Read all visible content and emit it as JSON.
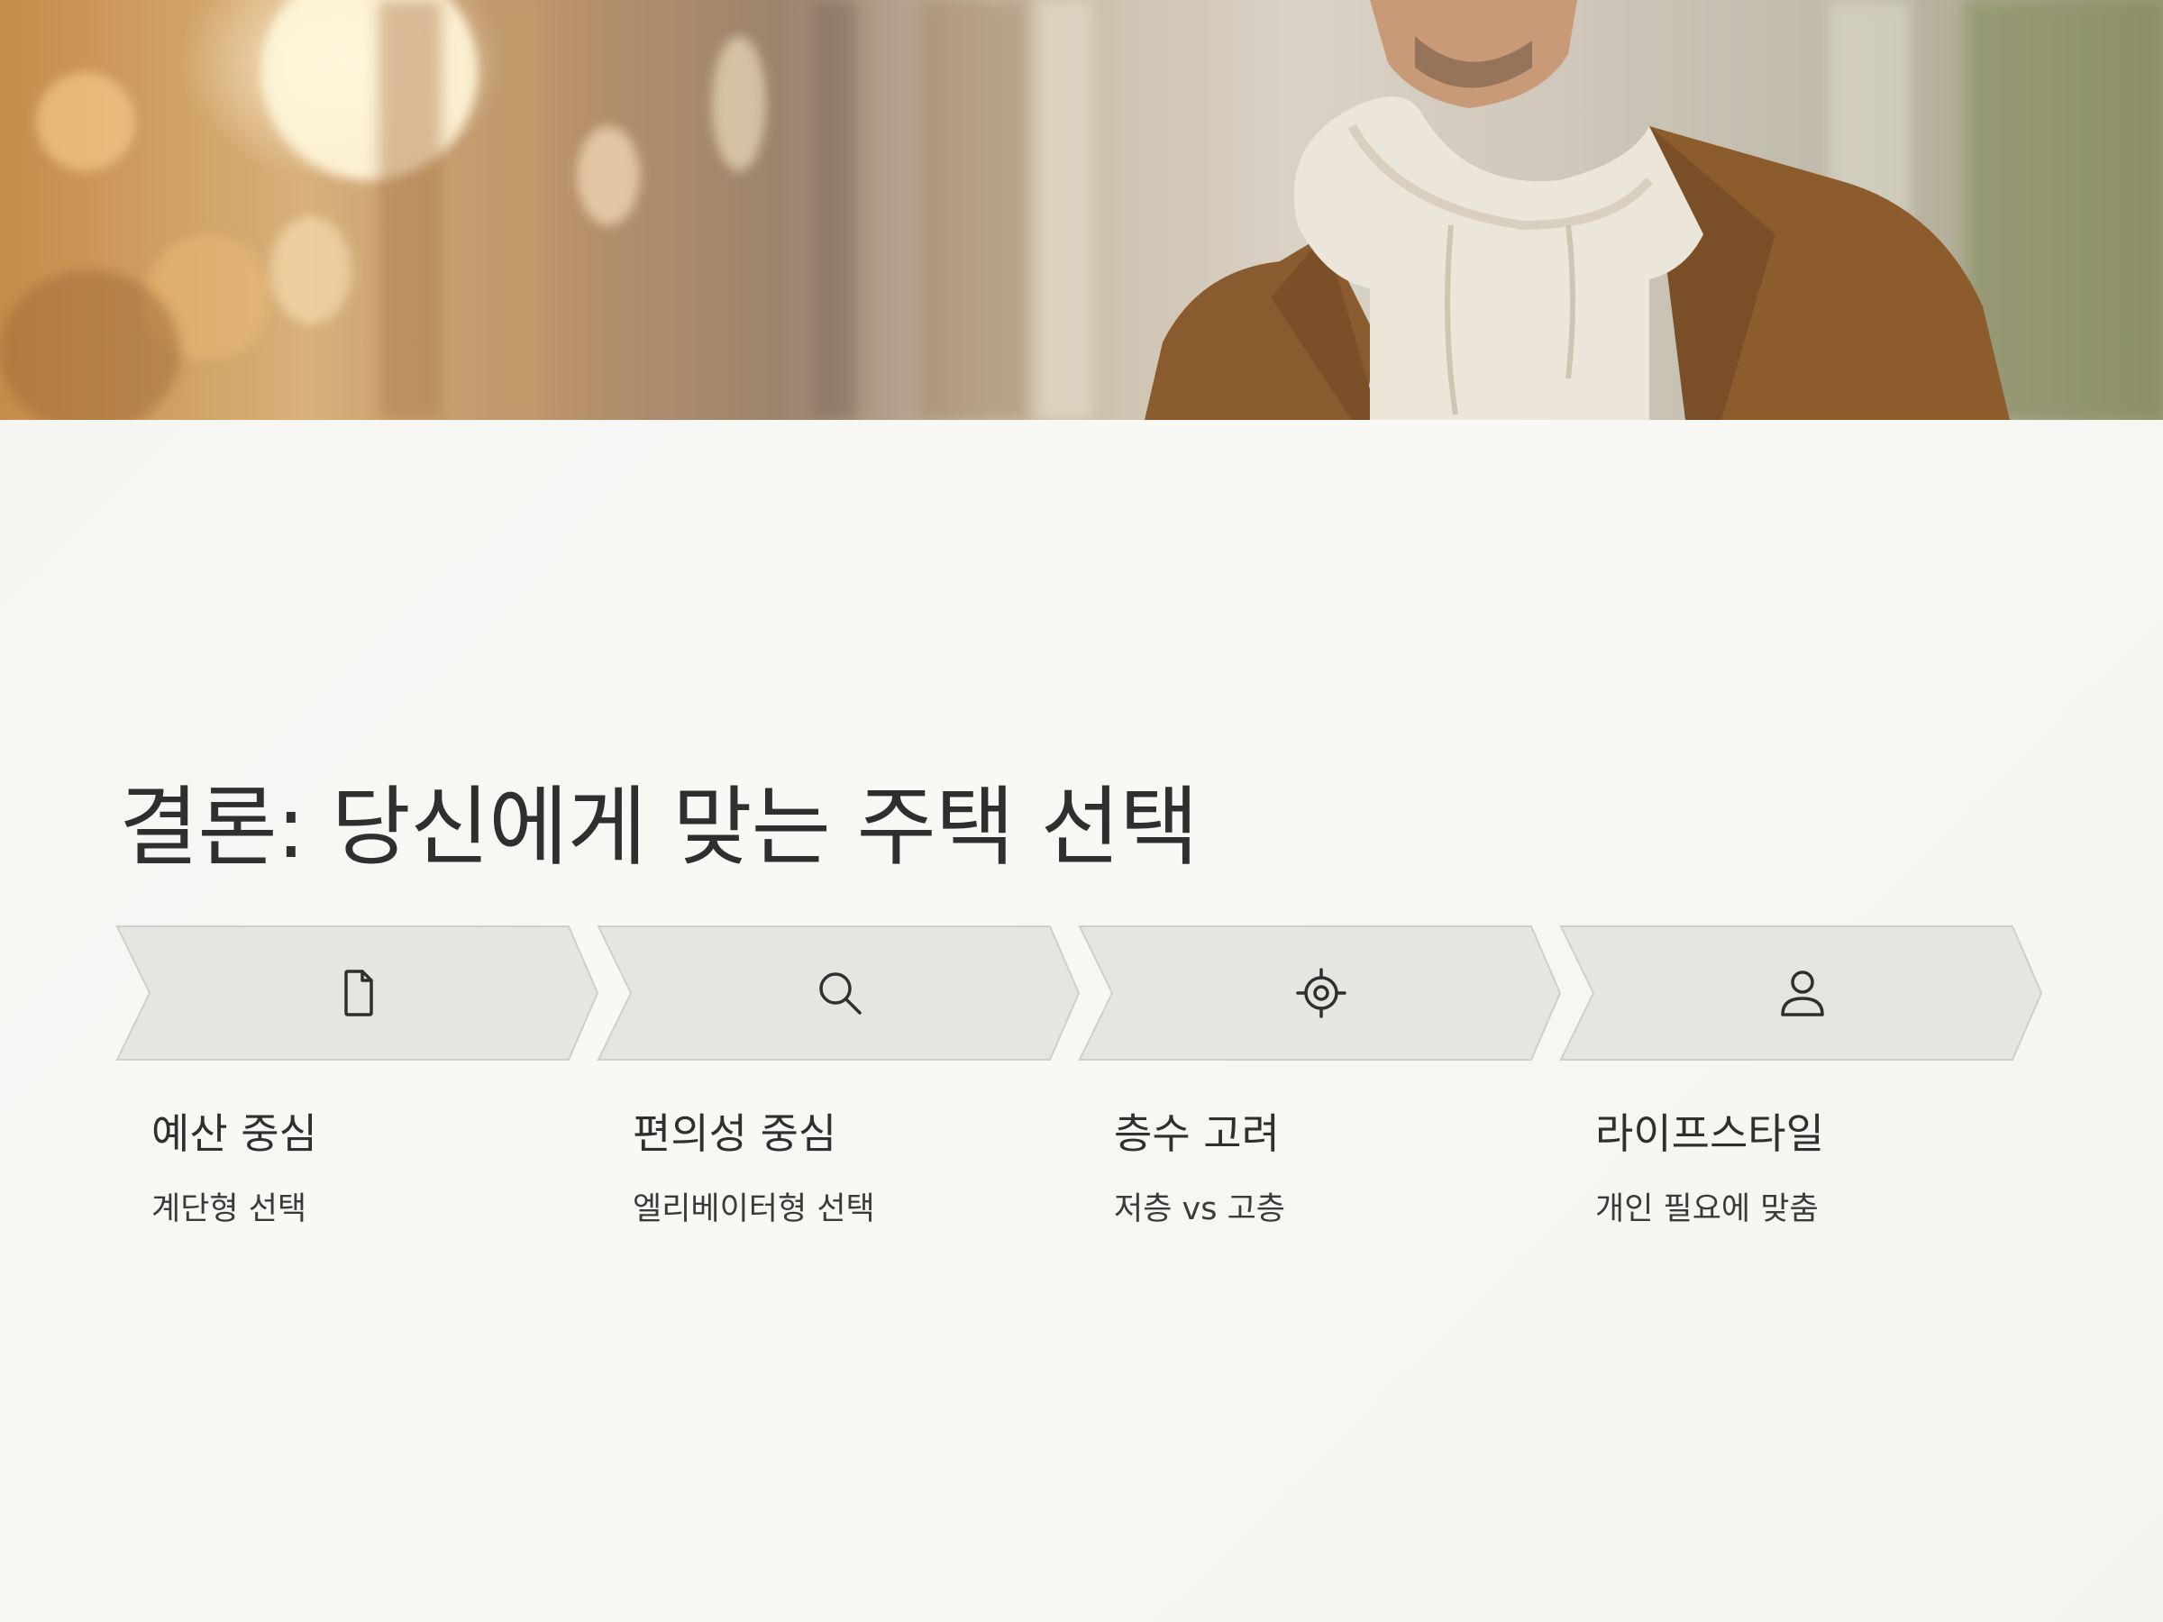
{
  "slide": {
    "title": "결론: 당신에게 맞는 주택 선택"
  },
  "hero": {
    "icon": "man-in-brown-jacket-photo"
  },
  "steps": [
    {
      "icon": "document-icon",
      "title": "예산 중심",
      "description": "계단형 선택"
    },
    {
      "icon": "search-icon",
      "title": "편의성 중심",
      "description": "엘리베이터형 선택"
    },
    {
      "icon": "target-icon",
      "title": "층수 고려",
      "description": "저층 vs 고층"
    },
    {
      "icon": "user-icon",
      "title": "라이프스타일",
      "description": "개인 필요에 맞춤"
    }
  ],
  "colors": {
    "background": "#f6f6f3",
    "chevron_fill": "#e6e6e1",
    "chevron_stroke": "#cfcfca",
    "text": "#2f2f2f"
  }
}
